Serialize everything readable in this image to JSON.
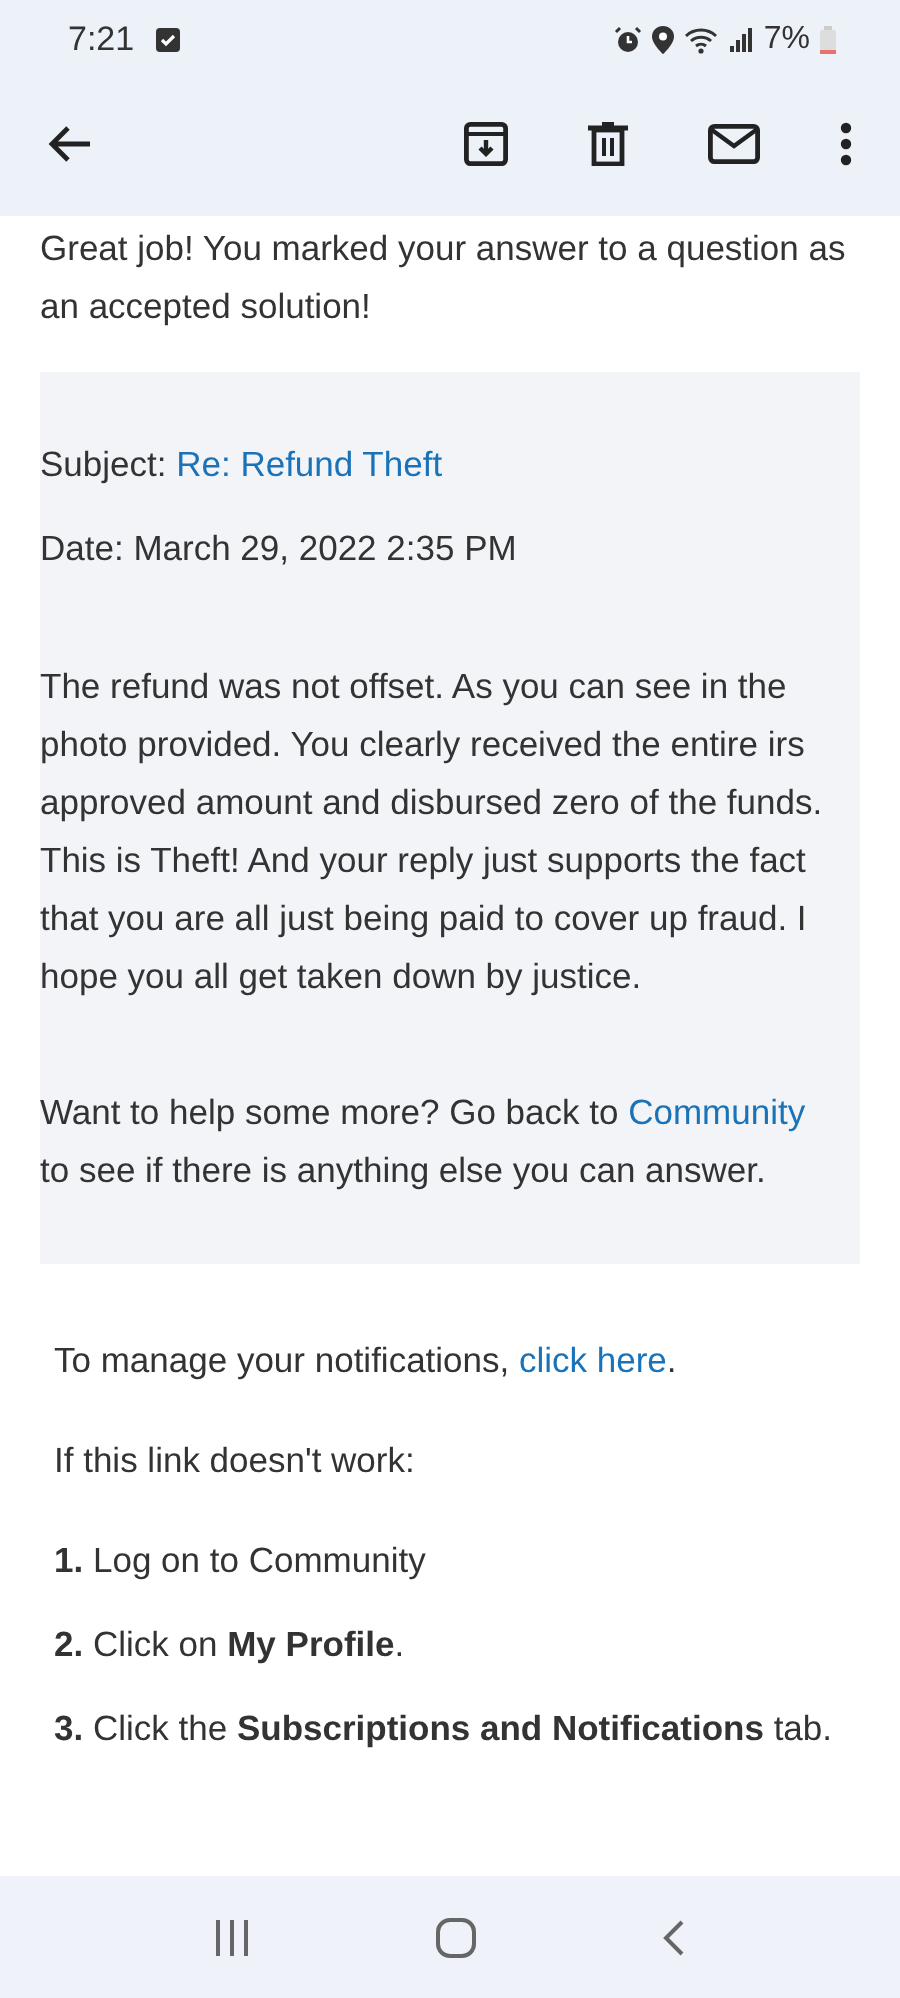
{
  "status_bar": {
    "time": "7:21",
    "battery": "7%"
  },
  "message": {
    "intro": "Great job! You marked your answer to a question as an accepted solution!",
    "subject_label": "Subject:",
    "subject_link": "Re: Refund Theft",
    "date": "Date: March 29, 2022 2:35 PM",
    "body": "The refund was not offset. As you can see in the photo provided. You clearly received the entire irs approved amount and disbursed zero of the funds. This is Theft! And your reply just supports the fact that you are all just being paid to cover up fraud. I hope you all get taken down by justice.",
    "more_text": "Want to help some more? Go back to",
    "more_link": "Community",
    "more_rest": "to see if there is anything else you can answer.",
    "manage_text": "To manage your notifications,",
    "manage_link": "click here",
    "manage_end": ".",
    "fallback": "If this link doesn't work:",
    "steps": [
      {
        "number": "1.",
        "text": "Log on to Community"
      },
      {
        "number": "2.",
        "text": "Click on **My Profile**."
      },
      {
        "number": "3.",
        "text": "Click the **Subscriptions and Notifications** tab."
      }
    ]
  }
}
